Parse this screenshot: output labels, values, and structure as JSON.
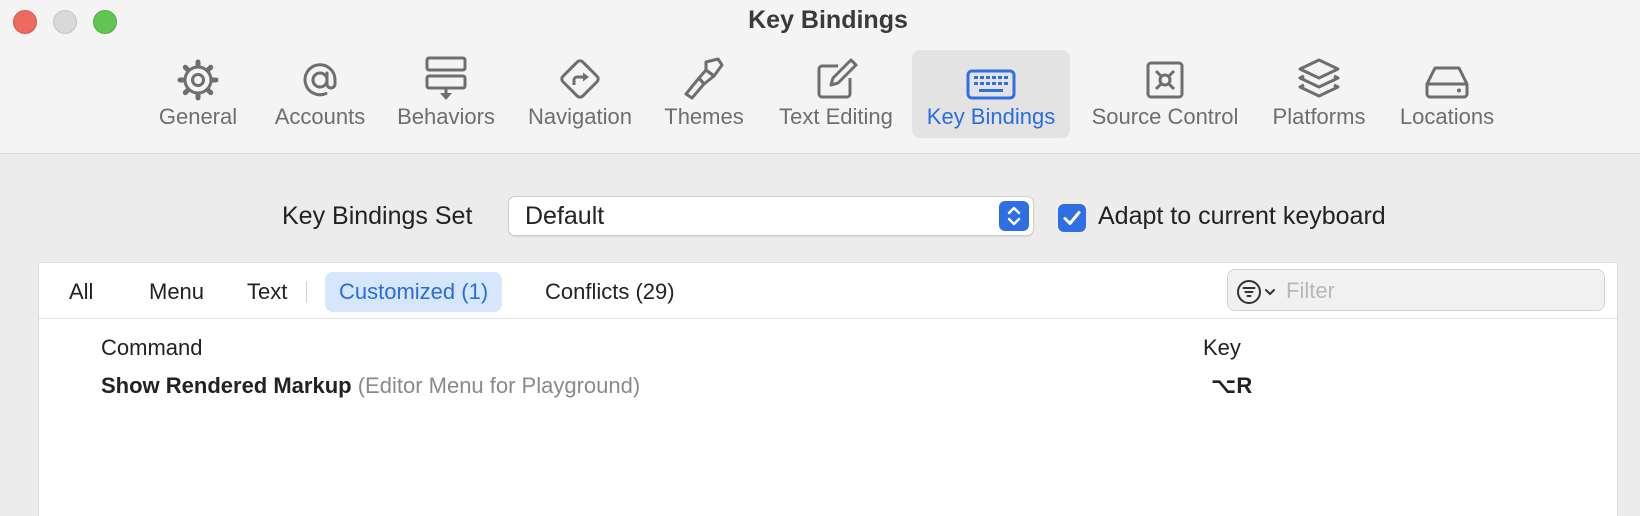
{
  "window": {
    "title": "Key Bindings"
  },
  "toolbar": {
    "tabs": [
      {
        "label": "General",
        "icon": "gear-icon"
      },
      {
        "label": "Accounts",
        "icon": "at-sign-icon"
      },
      {
        "label": "Behaviors",
        "icon": "behaviors-icon"
      },
      {
        "label": "Navigation",
        "icon": "navigation-sign-icon"
      },
      {
        "label": "Themes",
        "icon": "paintbrush-icon"
      },
      {
        "label": "Text Editing",
        "icon": "pencil-square-icon"
      },
      {
        "label": "Key Bindings",
        "icon": "keyboard-icon"
      },
      {
        "label": "Source Control",
        "icon": "source-control-icon"
      },
      {
        "label": "Platforms",
        "icon": "stacked-layers-icon"
      },
      {
        "label": "Locations",
        "icon": "drive-icon"
      }
    ],
    "selected_tab": "Key Bindings",
    "accent_color": "#2f6fe3"
  },
  "settings": {
    "set_label": "Key Bindings Set",
    "set_value": "Default",
    "adapt_label": "Adapt to current keyboard",
    "adapt_checked": true
  },
  "filterbar": {
    "scopes": [
      {
        "label": "All"
      },
      {
        "label": "Menu"
      },
      {
        "label": "Text"
      },
      {
        "label": "Customized (1)"
      },
      {
        "label": "Conflicts (29)"
      }
    ],
    "selected_scope": "Customized (1)",
    "filter_placeholder": "Filter",
    "filter_value": ""
  },
  "table": {
    "columns": {
      "command": "Command",
      "key": "Key"
    },
    "rows": [
      {
        "command": "Show Rendered Markup",
        "context": "(Editor Menu for Playground)",
        "key": "⌥R"
      }
    ]
  }
}
